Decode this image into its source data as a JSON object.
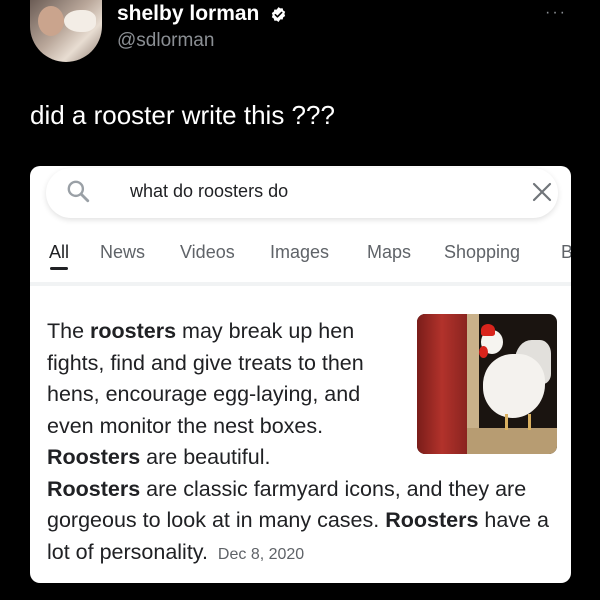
{
  "tweet": {
    "author_name": "shelby lorman",
    "author_handle": "@sdlorman",
    "more_label": "···",
    "text": "did a rooster write this ???"
  },
  "search": {
    "query": "what do roosters do",
    "icons": {
      "search": "search-icon",
      "clear": "close-icon"
    }
  },
  "tabs": [
    {
      "label": "All",
      "active": true
    },
    {
      "label": "News"
    },
    {
      "label": "Videos"
    },
    {
      "label": "Images"
    },
    {
      "label": "Maps"
    },
    {
      "label": "Shopping"
    },
    {
      "label": "B"
    }
  ],
  "snippet": {
    "line1_pre": "The ",
    "line1_bold": "roosters",
    "line1_post": " may break up hen fights, find and give treats to then hens, encourage egg-laying, and even monitor the nest boxes.",
    "s2_bold": "Roosters",
    "s2_post": " are beautiful.",
    "s3_bold": "Roosters",
    "s3_post": " are classic farmyard icons, and they are gorgeous to look at in many cases.",
    "s4_bold": "Roosters",
    "s4_post": " have a lot of personality.",
    "date": "Dec 8, 2020"
  },
  "colors": {
    "background": "#000000",
    "card": "#ffffff",
    "verified_badge": "#ffffff",
    "muted_text": "#5f6368"
  }
}
